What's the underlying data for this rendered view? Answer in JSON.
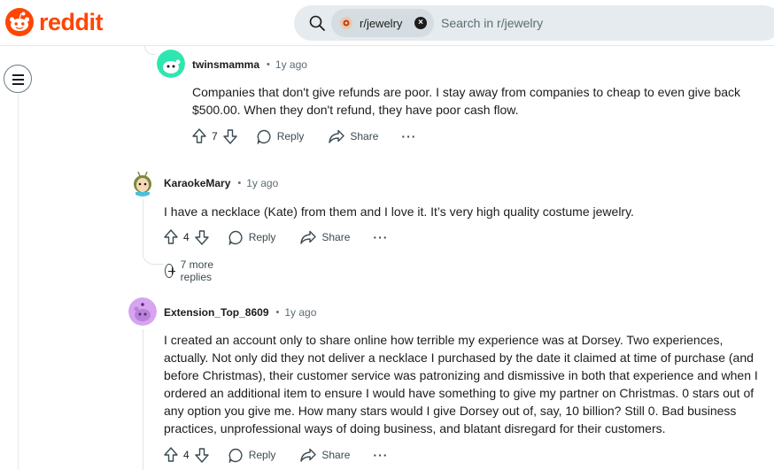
{
  "brand": {
    "name": "reddit",
    "accent": "#ff4500"
  },
  "search": {
    "chip_label": "r/jewelry",
    "chip_icon": "jewelry-subreddit-icon",
    "placeholder": "Search in r/jewelry"
  },
  "comments": [
    {
      "author": "twinsmamma",
      "time": "1y ago",
      "body": "Companies that don't give refunds are poor. I stay away from companies to cheap to even give back $500.00. When they don't refund, they have poor cash flow.",
      "votes": "7",
      "reply_label": "Reply",
      "share_label": "Share",
      "more_label": "···"
    },
    {
      "author": "KaraokeMary",
      "time": "1y ago",
      "body": "I have a necklace (Kate) from them and I love it. It’s very high quality costume jewelry.",
      "votes": "4",
      "reply_label": "Reply",
      "share_label": "Share",
      "more_label": "···",
      "more_replies": "7 more replies"
    },
    {
      "author": "Extension_Top_8609",
      "time": "1y ago",
      "body": "I created an account only to share online how terrible my experience was at Dorsey. Two experiences, actually. Not only did they not deliver a necklace I purchased by the date it claimed at time of purchase (and before Christmas), their customer service was patronizing and dismissive in both that experience and when I ordered an additional item to ensure I would have something to give my partner on Christmas. 0 stars out of any option you give me. How many stars would I give Dorsey out of, say, 10 billion? Still 0. Bad business practices, unprofessional ways of doing business, and blatant disregard for their customers.",
      "votes": "4",
      "reply_label": "Reply",
      "share_label": "Share",
      "more_label": "···"
    }
  ]
}
